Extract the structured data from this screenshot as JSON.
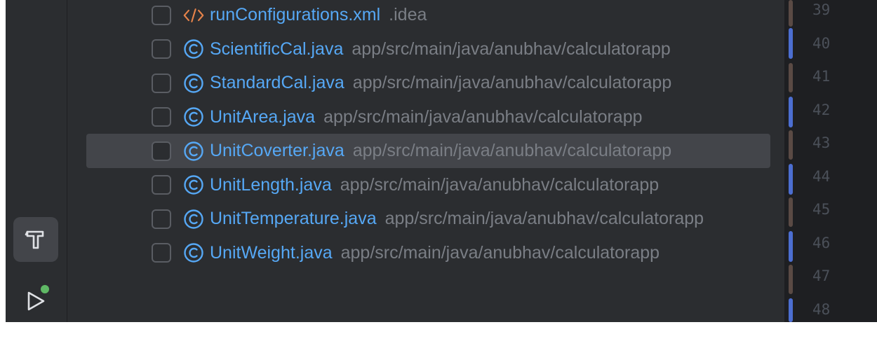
{
  "theme": {
    "accent_blue": "#56a8f5",
    "path_gray": "#7a7e85",
    "xml_orange": "#e6834a",
    "run_dot_green": "#5fb865",
    "gutter_blue": "#4c6ed1",
    "gutter_brown": "#5a4a44"
  },
  "toolstrip": {
    "build_icon": "hammer-icon",
    "run_icon": "run-icon"
  },
  "files": [
    {
      "name": "runConfigurations.xml",
      "path": ".idea",
      "icon": "xml-icon",
      "selected": false
    },
    {
      "name": "ScientificCal.java",
      "path": "app/src/main/java/anubhav/calculatorapp",
      "icon": "class-icon",
      "selected": false
    },
    {
      "name": "StandardCal.java",
      "path": "app/src/main/java/anubhav/calculatorapp",
      "icon": "class-icon",
      "selected": false
    },
    {
      "name": "UnitArea.java",
      "path": "app/src/main/java/anubhav/calculatorapp",
      "icon": "class-icon",
      "selected": false
    },
    {
      "name": "UnitCoverter.java",
      "path": "app/src/main/java/anubhav/calculatorapp",
      "icon": "class-icon",
      "selected": true
    },
    {
      "name": "UnitLength.java",
      "path": "app/src/main/java/anubhav/calculatorapp",
      "icon": "class-icon",
      "selected": false
    },
    {
      "name": "UnitTemperature.java",
      "path": "app/src/main/java/anubhav/calculatorapp",
      "icon": "class-icon",
      "selected": false
    },
    {
      "name": "UnitWeight.java",
      "path": "app/src/main/java/anubhav/calculatorapp",
      "icon": "class-icon",
      "selected": false
    }
  ],
  "gutter": {
    "line_numbers": [
      "39",
      "40",
      "41",
      "42",
      "43",
      "44",
      "45",
      "46",
      "47",
      "48"
    ]
  }
}
